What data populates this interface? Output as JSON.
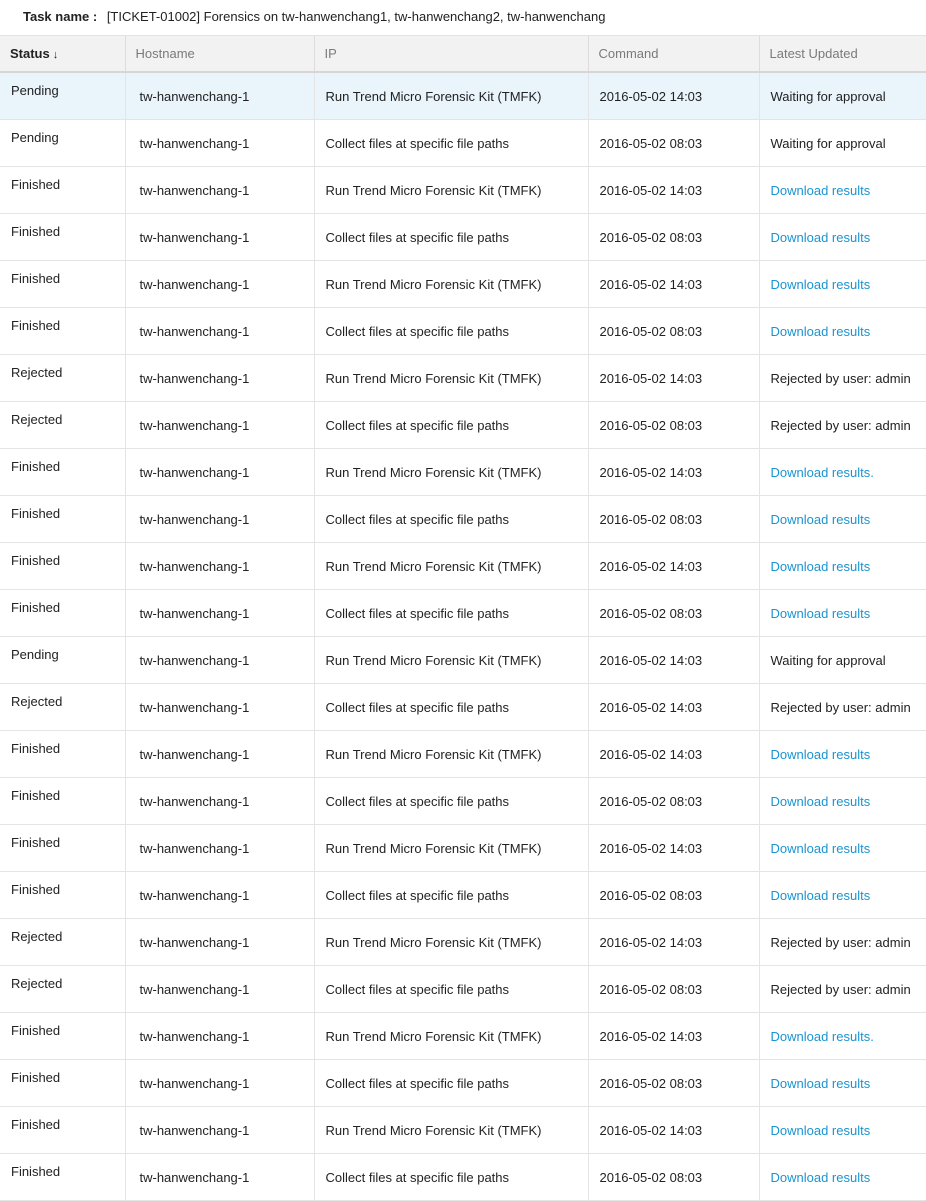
{
  "task": {
    "label": "Task name :",
    "value": "[TICKET-01002] Forensics on tw-hanwenchang1, tw-hanwenchang2, tw-hanwenchang"
  },
  "columns": {
    "status": "Status",
    "sort_icon": "↓",
    "hostname": "Hostname",
    "ip": "IP",
    "command": "Command",
    "latest_updated": "Latest Updated"
  },
  "colors": {
    "link": "#1a94d1",
    "selected_row": "#e9f4fb",
    "header_bg": "#f2f2f2"
  },
  "rows": [
    {
      "status": "Pending",
      "hostname": "tw-hanwenchang-1",
      "ip": "Run Trend Micro Forensic Kit (TMFK)",
      "command": "2016-05-02 14:03",
      "updated": "Waiting for approval",
      "link": false,
      "selected": true
    },
    {
      "status": "Pending",
      "hostname": "tw-hanwenchang-1",
      "ip": "Collect files at specific file paths",
      "command": "2016-05-02 08:03",
      "updated": "Waiting for approval",
      "link": false
    },
    {
      "status": "Finished",
      "hostname": "tw-hanwenchang-1",
      "ip": "Run Trend Micro Forensic Kit (TMFK)",
      "command": "2016-05-02 14:03",
      "updated": "Download results",
      "link": true
    },
    {
      "status": "Finished",
      "hostname": "tw-hanwenchang-1",
      "ip": "Collect files at specific file paths",
      "command": "2016-05-02 08:03",
      "updated": "Download results",
      "link": true
    },
    {
      "status": "Finished",
      "hostname": "tw-hanwenchang-1",
      "ip": "Run Trend Micro Forensic Kit (TMFK)",
      "command": "2016-05-02 14:03",
      "updated": "Download results",
      "link": true
    },
    {
      "status": "Finished",
      "hostname": "tw-hanwenchang-1",
      "ip": "Collect files at specific file paths",
      "command": "2016-05-02 08:03",
      "updated": "Download results",
      "link": true
    },
    {
      "status": "Rejected",
      "hostname": "tw-hanwenchang-1",
      "ip": "Run Trend Micro Forensic Kit (TMFK)",
      "command": "2016-05-02 14:03",
      "updated": "Rejected by user: admin",
      "link": false
    },
    {
      "status": "Rejected",
      "hostname": "tw-hanwenchang-1",
      "ip": "Collect files at specific file paths",
      "command": "2016-05-02 08:03",
      "updated": "Rejected by user: admin",
      "link": false
    },
    {
      "status": "Finished",
      "hostname": "tw-hanwenchang-1",
      "ip": "Run Trend Micro Forensic Kit (TMFK)",
      "command": "2016-05-02 14:03",
      "updated": "Download results.",
      "link": true
    },
    {
      "status": "Finished",
      "hostname": "tw-hanwenchang-1",
      "ip": "Collect files at specific file paths",
      "command": "2016-05-02 08:03",
      "updated": "Download results",
      "link": true
    },
    {
      "status": "Finished",
      "hostname": "tw-hanwenchang-1",
      "ip": "Run Trend Micro Forensic Kit (TMFK)",
      "command": "2016-05-02 14:03",
      "updated": "Download results",
      "link": true
    },
    {
      "status": "Finished",
      "hostname": "tw-hanwenchang-1",
      "ip": "Collect files at specific file paths",
      "command": "2016-05-02 08:03",
      "updated": "Download results",
      "link": true
    },
    {
      "status": "Pending",
      "hostname": "tw-hanwenchang-1",
      "ip": "Run Trend Micro Forensic Kit (TMFK)",
      "command": "2016-05-02 14:03",
      "updated": "Waiting for approval",
      "link": false
    },
    {
      "status": "Rejected",
      "hostname": "tw-hanwenchang-1",
      "ip": "Collect files at specific file paths",
      "command": "2016-05-02 14:03",
      "updated": "Rejected by user: admin",
      "link": false
    },
    {
      "status": "Finished",
      "hostname": "tw-hanwenchang-1",
      "ip": "Run Trend Micro Forensic Kit (TMFK)",
      "command": "2016-05-02 14:03",
      "updated": "Download results",
      "link": true
    },
    {
      "status": "Finished",
      "hostname": "tw-hanwenchang-1",
      "ip": "Collect files at specific file paths",
      "command": "2016-05-02 08:03",
      "updated": "Download results",
      "link": true
    },
    {
      "status": "Finished",
      "hostname": "tw-hanwenchang-1",
      "ip": "Run Trend Micro Forensic Kit (TMFK)",
      "command": "2016-05-02 14:03",
      "updated": "Download results",
      "link": true
    },
    {
      "status": "Finished",
      "hostname": "tw-hanwenchang-1",
      "ip": "Collect files at specific file paths",
      "command": "2016-05-02 08:03",
      "updated": "Download results",
      "link": true
    },
    {
      "status": "Rejected",
      "hostname": "tw-hanwenchang-1",
      "ip": "Run Trend Micro Forensic Kit (TMFK)",
      "command": "2016-05-02 14:03",
      "updated": "Rejected by user: admin",
      "link": false
    },
    {
      "status": "Rejected",
      "hostname": "tw-hanwenchang-1",
      "ip": "Collect files at specific file paths",
      "command": "2016-05-02 08:03",
      "updated": "Rejected by user: admin",
      "link": false
    },
    {
      "status": "Finished",
      "hostname": "tw-hanwenchang-1",
      "ip": "Run Trend Micro Forensic Kit (TMFK)",
      "command": "2016-05-02 14:03",
      "updated": "Download results.",
      "link": true
    },
    {
      "status": "Finished",
      "hostname": "tw-hanwenchang-1",
      "ip": "Collect files at specific file paths",
      "command": "2016-05-02 08:03",
      "updated": "Download results",
      "link": true
    },
    {
      "status": "Finished",
      "hostname": "tw-hanwenchang-1",
      "ip": "Run Trend Micro Forensic Kit (TMFK)",
      "command": "2016-05-02 14:03",
      "updated": "Download results",
      "link": true
    },
    {
      "status": "Finished",
      "hostname": "tw-hanwenchang-1",
      "ip": "Collect files at specific file paths",
      "command": "2016-05-02 08:03",
      "updated": "Download results",
      "link": true
    }
  ]
}
